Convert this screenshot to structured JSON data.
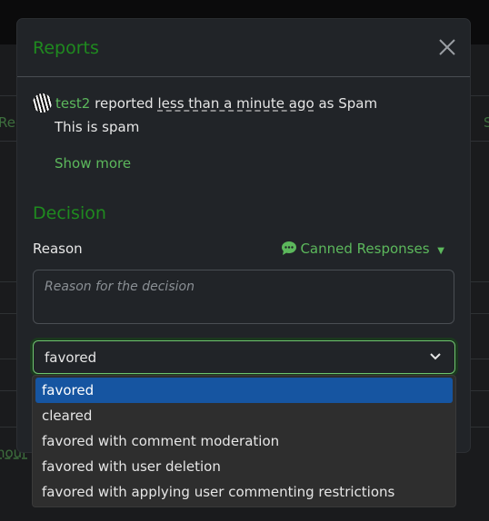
{
  "background": {
    "left_text": "Rec",
    "right_text": "S",
    "bottom_text": "hour"
  },
  "modal": {
    "title": "Reports",
    "close_icon": "close-icon",
    "report": {
      "user": "test2",
      "verb": "reported",
      "time": "less than a minute ago",
      "suffix": "as Spam",
      "message": "This is spam",
      "show_more": "Show more"
    },
    "decision": {
      "heading": "Decision",
      "reason_label": "Reason",
      "canned_label": "Canned Responses",
      "reason_placeholder": "Reason for the decision",
      "selected": "favored",
      "options": [
        "favored",
        "cleared",
        "favored with comment moderation",
        "favored with user deletion",
        "favored with applying user commenting restrictions"
      ]
    }
  },
  "colors": {
    "accent": "#5cb85c",
    "title": "#1f8a1f",
    "selected_option": "#1655a1"
  }
}
